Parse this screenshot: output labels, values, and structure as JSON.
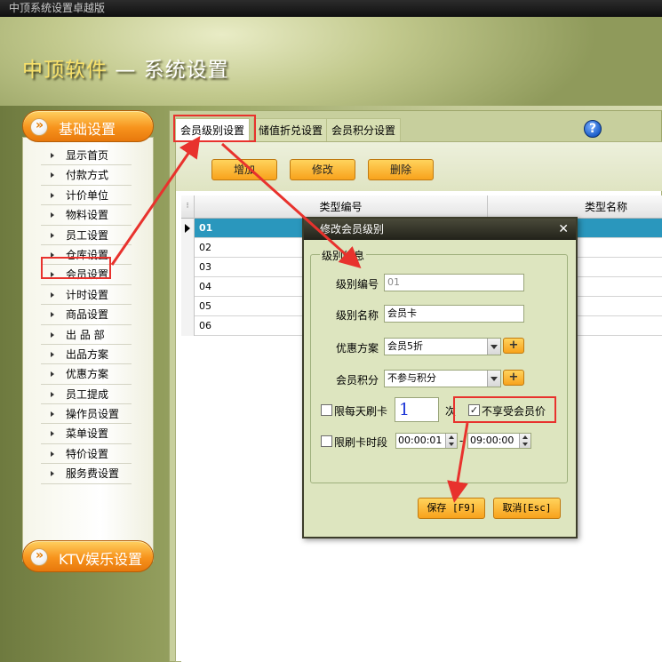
{
  "window": {
    "title": "中顶系统设置卓越版"
  },
  "banner": {
    "brand": "中顶软件",
    "separator": "—",
    "section": "系统设置"
  },
  "sidebar": {
    "top_group": "基础设置",
    "bottom_group": "KTV娱乐设置",
    "items": [
      "显示首页",
      "付款方式",
      "计价单位",
      "物料设置",
      "员工设置",
      "仓库设置",
      "会员设置",
      "计时设置",
      "商品设置",
      "出 品 部",
      "出品方案",
      "优惠方案",
      "员工提成",
      "操作员设置",
      "菜单设置",
      "特价设置",
      "服务费设置"
    ],
    "selected_index": 6
  },
  "tabs": [
    {
      "label": "会员级别设置",
      "active": true
    },
    {
      "label": "储值折兑设置",
      "active": false
    },
    {
      "label": "会员积分设置",
      "active": false
    }
  ],
  "help": {
    "glyph": "?"
  },
  "toolbar": {
    "add": "增加",
    "edit": "修改",
    "delete": "删除"
  },
  "grid": {
    "columns": [
      "类型编号",
      "类型名称"
    ],
    "rows": [
      "01",
      "02",
      "03",
      "04",
      "05",
      "06"
    ],
    "selected_index": 0
  },
  "modal": {
    "title": "修改会员级别",
    "close": "✕",
    "group": "级别信息",
    "level_code_label": "级别编号",
    "level_code": "01",
    "level_name_label": "级别名称",
    "level_name": "会员卡",
    "discount_label": "优惠方案",
    "discount": "会员5折",
    "points_label": "会员积分",
    "points": "不参与积分",
    "plus": "+",
    "daily_limit_label": "限每天刷卡",
    "daily_limit_checked": false,
    "daily_limit_value": "1",
    "times_unit": "次",
    "no_member_price_label": "不享受会员价",
    "no_member_price_checked": true,
    "time_limit_label": "限刷卡时段",
    "time_limit_checked": false,
    "time_start": "00:00:01",
    "time_sep": "-",
    "time_end": "09:00:00",
    "save": "保存 [F9]",
    "cancel": "取消[Esc]"
  },
  "colors": {
    "accent": "#f7931c",
    "annotation": "#e8322d",
    "selection": "#2a97bd"
  }
}
